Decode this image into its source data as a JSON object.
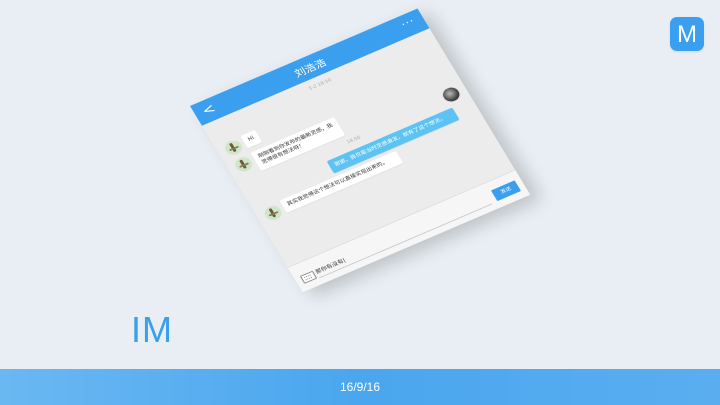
{
  "logo": {
    "letter": "M"
  },
  "slide": {
    "label": "IM",
    "date": "16/9/16"
  },
  "phone": {
    "title": "刘浩浩",
    "back_glyph": "<",
    "more_glyph": "···",
    "timestamps": [
      "5-2 18:50",
      "18:56"
    ],
    "messages": [
      {
        "side": "left",
        "text": "Hi"
      },
      {
        "side": "left",
        "text": "刚刚看到你发布的最新灵感，我觉得很有想法呀！"
      },
      {
        "side": "right",
        "text": "谢谢，我也是当时灵感激发，就有了这个想法。"
      },
      {
        "side": "left",
        "text": "其实我觉得这个想法可以直接实现出来的。"
      }
    ],
    "composer": {
      "value": "那你有没有|",
      "send_label": "发送"
    }
  }
}
